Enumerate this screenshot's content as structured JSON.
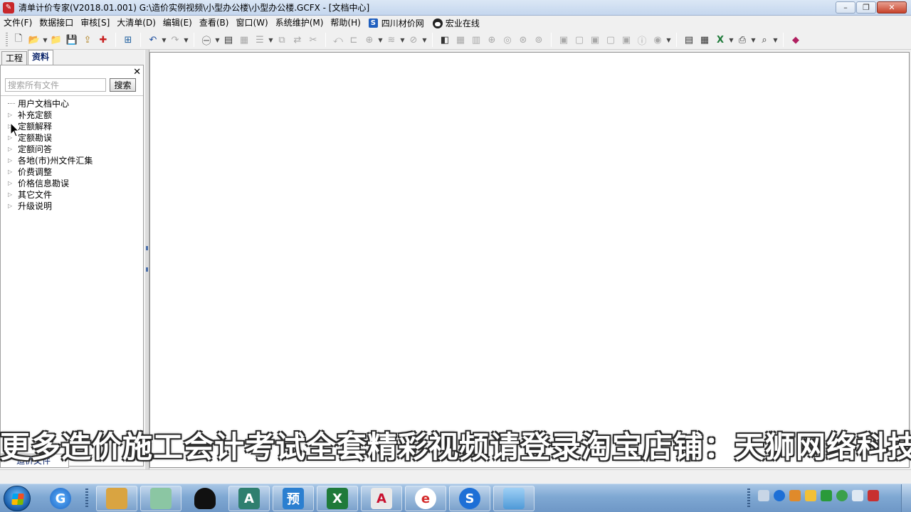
{
  "window": {
    "title": "清单计价专家(V2018.01.001) G:\\造价实例视频\\小型办公楼\\小型办公楼.GCFX - [文档中心]",
    "app_icon": "app-logo-icon",
    "buttons": {
      "minimize": "–",
      "restore": "❐",
      "close": "✕"
    }
  },
  "menu": {
    "items": [
      "文件(F)",
      "数据接口",
      "审核[S]",
      "大清单(D)",
      "编辑(E)",
      "查看(B)",
      "窗口(W)",
      "系统维护(M)",
      "帮助(H)"
    ],
    "links": [
      "四川材价网",
      "宏业在线"
    ]
  },
  "toolbar": {
    "icons": [
      "new-file-icon",
      "open-folder-icon",
      "folder-icon",
      "save-icon",
      "export-icon",
      "add-red-icon",
      "calculator-icon",
      "undo-icon",
      "redo-icon",
      "font-icon",
      "document-icon",
      "grid-icon",
      "align-icon",
      "copy-icon",
      "move-icon",
      "cut-icon",
      "undo-alt-icon",
      "hierarchy-icon",
      "lock-icon",
      "brush-icon",
      "paint-icon",
      "table-view-icon",
      "table-icon",
      "columns-icon",
      "zhong-icon",
      "wei-icon",
      "cha-icon",
      "jian-icon",
      "ding-icon",
      "mu-icon",
      "ding2-icon",
      "ke-icon",
      "quan-icon",
      "info-icon",
      "eye-icon",
      "report-icon",
      "calc-table-icon",
      "excel-icon",
      "print-icon",
      "print-preview-icon",
      "book-icon"
    ]
  },
  "left_panel": {
    "tabs": [
      "工程",
      "资料"
    ],
    "active_tab": 1,
    "close_label": "✕",
    "search": {
      "placeholder": "搜索所有文件",
      "value": "",
      "button_label": "搜索"
    },
    "tree": [
      {
        "label": "用户文档中心",
        "expandable": false
      },
      {
        "label": "补充定额",
        "expandable": true
      },
      {
        "label": "定额解释",
        "expandable": true
      },
      {
        "label": "定额勘误",
        "expandable": true
      },
      {
        "label": "定额问答",
        "expandable": true
      },
      {
        "label": "各地(市)州文件汇集",
        "expandable": true
      },
      {
        "label": "价费调整",
        "expandable": true
      },
      {
        "label": "价格信息勘误",
        "expandable": true
      },
      {
        "label": "其它文件",
        "expandable": true
      },
      {
        "label": "升级说明",
        "expandable": true
      }
    ],
    "bottom_tab": "造价文件"
  },
  "caption": "更多造价施工会计考试全套精彩视频请登录淘宝店铺：天狮网络科技",
  "taskbar": {
    "apps": [
      {
        "name": "windows-explorer-icon",
        "label": "",
        "color": "#d9a441"
      },
      {
        "name": "maps-app-icon",
        "label": "",
        "color": "#8bc6a3"
      },
      {
        "name": "qq-penguin-icon",
        "label": "",
        "color": "#111111"
      },
      {
        "name": "autocad-icon",
        "label": "A",
        "color": "#2f7f6f"
      },
      {
        "name": "yu-budget-icon",
        "label": "预",
        "color": "#2b7fd0"
      },
      {
        "name": "excel-icon",
        "label": "X",
        "color": "#1f7a3a"
      },
      {
        "name": "pdf-icon",
        "label": "A",
        "color": "#e9e9e9"
      },
      {
        "name": "red-swirl-app-icon",
        "label": "e",
        "color": "#d42a2a"
      },
      {
        "name": "sogou-s-icon",
        "label": "S",
        "color": "#1d6fd6"
      },
      {
        "name": "photo-viewer-icon",
        "label": "",
        "color": "#4f9ad8"
      }
    ],
    "tray_icons": [
      "keyboard-icon",
      "sogou-tray-icon",
      "network-share-icon",
      "security-shield-icon",
      "flag-tray-icon",
      "check-tray-icon",
      "volume-icon",
      "network-icon"
    ]
  }
}
